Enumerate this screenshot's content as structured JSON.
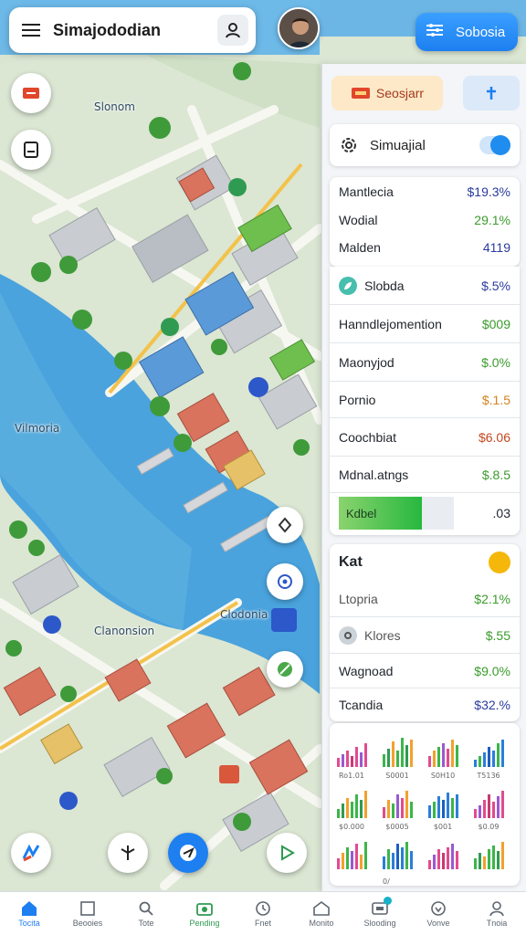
{
  "header": {
    "app_title": "Simajododian",
    "menu_icon": "hamburger-menu-icon",
    "user_icon": "user-icon",
    "action_button_label": "Sobosia",
    "action_icon": "list-icon"
  },
  "map": {
    "labels": [
      "Slonom",
      "Vilmoria",
      "Clanonsion",
      "Clodonia"
    ]
  },
  "panel": {
    "chip_primary_label": "Seosjarr",
    "chip_secondary_icon": "pin-icon",
    "toggle_label": "Simuajial",
    "toggle_on": true,
    "list1": [
      {
        "label": "Mantlecia",
        "value": "$19.3%",
        "color": "#2a3b9e"
      },
      {
        "label": "Wodial",
        "value": "29.1%",
        "color": "#3a9b2b"
      },
      {
        "label": "Malden",
        "value": "4119",
        "color": "#2a3b9e"
      }
    ],
    "list2": [
      {
        "label": "Slobda",
        "value": "$.5%",
        "color": "#2a3b9e",
        "icon": "leaf-icon"
      },
      {
        "label": "Hanndlejomention",
        "value": "$009",
        "color": "#3a9b2b"
      },
      {
        "label": "Maonyjod",
        "value": "$.0%",
        "color": "#3a9b2b"
      },
      {
        "label": "Pornio",
        "value": "$.1.5",
        "color": "#d2821e"
      },
      {
        "label": "Coochbiat",
        "value": "$6.06",
        "color": "#c3461e"
      },
      {
        "label": "Mdnal.atngs",
        "value": "$.8.5",
        "color": "#3a9b2b"
      }
    ],
    "progress": {
      "label": "Kdbel",
      "value": ".03",
      "fill": 0.72
    },
    "list3_title": "Kat",
    "list3": [
      {
        "label": "Ltopria",
        "value": "$2.1%",
        "color": "#3a9b2b"
      },
      {
        "label": "Klores",
        "value": "$.55",
        "color": "#3a9b2b",
        "icon": "settings-icon"
      },
      {
        "label": "Wagnoad",
        "value": "$9.0%",
        "color": "#3a9b2b"
      },
      {
        "label": "Tcandia",
        "value": "$32.%",
        "color": "#2a3b9e"
      }
    ],
    "minicharts_labels": [
      "Ro1.01",
      "S0001",
      "S0H10",
      "T5136",
      "$0.000",
      "$0005",
      "$001",
      "$0.09",
      "0/"
    ]
  },
  "bottom_nav": [
    {
      "label": "Tocita",
      "icon": "home-icon",
      "active": true
    },
    {
      "label": "Beooies",
      "icon": "document-icon"
    },
    {
      "label": "Tote",
      "icon": "search-icon"
    },
    {
      "label": "Pending",
      "icon": "camera-icon"
    },
    {
      "label": "Fnet",
      "icon": "clock-icon"
    },
    {
      "label": "Monito",
      "icon": "building-icon"
    },
    {
      "label": "Slooding",
      "icon": "card-icon",
      "badge": true
    },
    {
      "label": "Vonve",
      "icon": "heart-icon"
    },
    {
      "label": "Tnoia",
      "icon": "profile-icon"
    }
  ]
}
